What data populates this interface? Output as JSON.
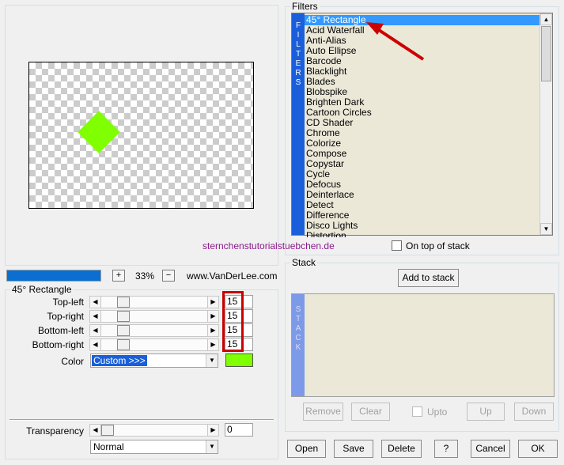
{
  "preview": {
    "zoom": "33%",
    "plus_label": "+",
    "minus_label": "−",
    "site": "www.VanDerLee.com"
  },
  "colors": {
    "shape": "#80ff00",
    "accent": "#1a5fd9",
    "highlight": "#cc0000"
  },
  "watermark": "sternchenstutorialstuebchen.de",
  "params": {
    "title": "45° Rectangle",
    "sliders": [
      {
        "label": "Top-left",
        "value": "15"
      },
      {
        "label": "Top-right",
        "value": "15"
      },
      {
        "label": "Bottom-left",
        "value": "15"
      },
      {
        "label": "Bottom-right",
        "value": "15"
      }
    ],
    "color_label": "Color",
    "color_value": "Custom >>>",
    "transparency_label": "Transparency",
    "transparency_value": "0",
    "blend_value": "Normal"
  },
  "filters": {
    "title": "Filters",
    "strip": [
      "F",
      "I",
      "L",
      "T",
      "E",
      "R",
      "S"
    ],
    "items": [
      "45° Rectangle",
      "Acid Waterfall",
      "Anti-Alias",
      "Auto Ellipse",
      "Barcode",
      "Blacklight",
      "Blades",
      "Blobspike",
      "Brighten Dark",
      "Cartoon Circles",
      "CD Shader",
      "Chrome",
      "Colorize",
      "Compose",
      "Copystar",
      "Cycle",
      "Defocus",
      "Deinterlace",
      "Detect",
      "Difference",
      "Disco Lights",
      "Distortion"
    ],
    "selected": "45° Rectangle",
    "on_top_label": "On top of stack"
  },
  "stack": {
    "title": "Stack",
    "add_label": "Add to stack",
    "strip": [
      "S",
      "T",
      "A",
      "C",
      "K"
    ],
    "remove_label": "Remove",
    "clear_label": "Clear",
    "upto_label": "Upto",
    "up_label": "Up",
    "down_label": "Down"
  },
  "footer": {
    "open": "Open",
    "save": "Save",
    "delete": "Delete",
    "help": "?",
    "cancel": "Cancel",
    "ok": "OK"
  }
}
